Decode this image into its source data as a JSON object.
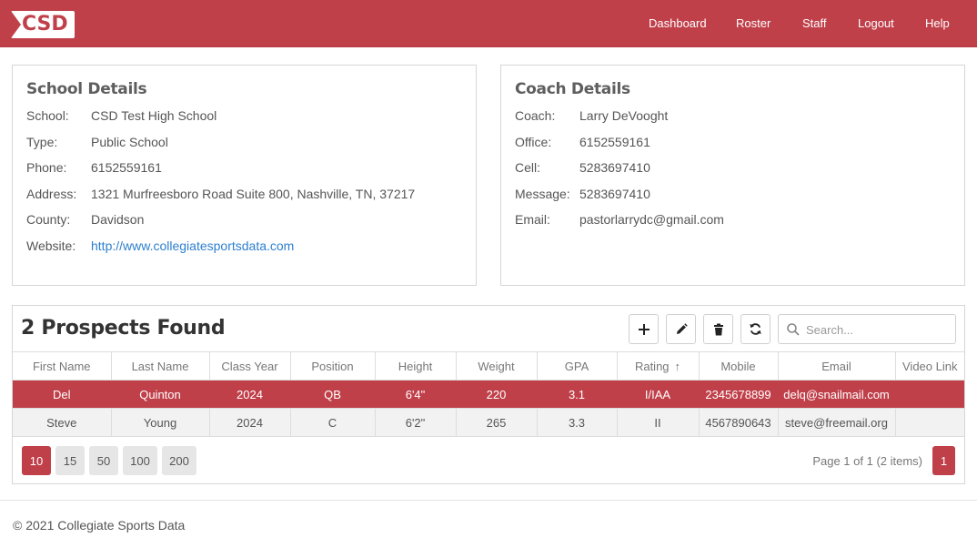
{
  "header": {
    "logo_text": "CSD",
    "nav": [
      "Dashboard",
      "Roster",
      "Staff",
      "Logout",
      "Help"
    ]
  },
  "school": {
    "title": "School Details",
    "rows": [
      {
        "label": "School:",
        "value": "CSD Test High School"
      },
      {
        "label": "Type:",
        "value": "Public School"
      },
      {
        "label": "Phone:",
        "value": "6152559161"
      },
      {
        "label": "Address:",
        "value": "1321 Murfreesboro Road Suite 800, Nashville, TN, 37217"
      },
      {
        "label": "County:",
        "value": "Davidson"
      },
      {
        "label": "Website:",
        "value": "http://www.collegiatesportsdata.com"
      }
    ]
  },
  "coach": {
    "title": "Coach Details",
    "rows": [
      {
        "label": "Coach:",
        "value": "Larry DeVooght"
      },
      {
        "label": "Office:",
        "value": "6152559161"
      },
      {
        "label": "Cell:",
        "value": "5283697410"
      },
      {
        "label": "Message:",
        "value": "5283697410"
      },
      {
        "label": "Email:",
        "value": "pastorlarrydc@gmail.com"
      }
    ]
  },
  "prospects": {
    "title": "2 Prospects Found",
    "search_placeholder": "Search...",
    "columns": [
      "First Name",
      "Last Name",
      "Class Year",
      "Position",
      "Height",
      "Weight",
      "GPA",
      "Rating",
      "Mobile",
      "Email",
      "Video Link"
    ],
    "rows": [
      [
        "Del",
        "Quinton",
        "2024",
        "QB",
        "6'4\"",
        "220",
        "3.1",
        "I/IAA",
        "2345678899",
        "delq@snailmail.com",
        ""
      ],
      [
        "Steve",
        "Young",
        "2024",
        "C",
        "6'2\"",
        "265",
        "3.3",
        "II",
        "4567890643",
        "steve@freemail.org",
        ""
      ]
    ],
    "page_sizes": [
      "10",
      "15",
      "50",
      "100",
      "200"
    ],
    "page_info": "Page 1 of 1 (2 items)",
    "current_page": "1"
  },
  "footer": {
    "copyright": "© 2021 Collegiate Sports Data"
  },
  "colors": {
    "brand": "#c0404a",
    "link": "#2d7fcf"
  }
}
